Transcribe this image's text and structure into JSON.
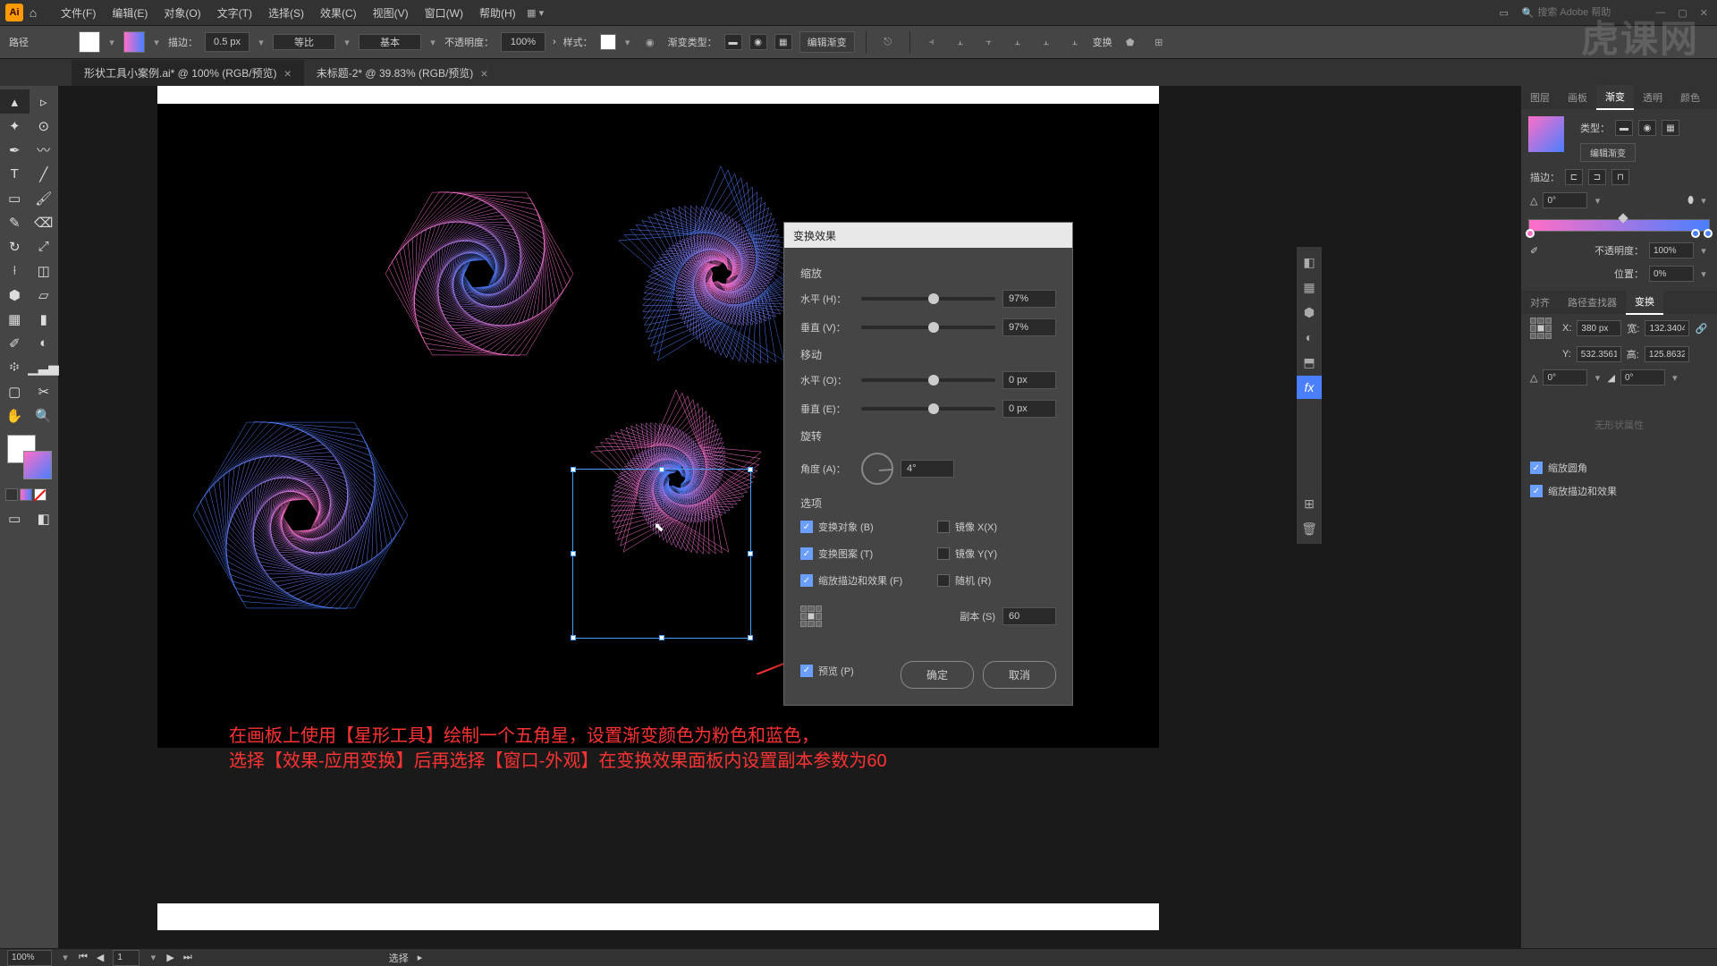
{
  "menubar": {
    "items": [
      "文件(F)",
      "编辑(E)",
      "对象(O)",
      "文字(T)",
      "选择(S)",
      "效果(C)",
      "视图(V)",
      "窗口(W)",
      "帮助(H)"
    ],
    "search_placeholder": "搜索 Adobe 帮助"
  },
  "controlbar": {
    "path_label": "路径",
    "stroke_label": "描边：",
    "stroke_width": "0.5 px",
    "profile": "等比",
    "brush": "基本",
    "opacity_label": "不透明度：",
    "opacity": "100%",
    "style_label": "样式：",
    "grad_type_label": "渐变类型：",
    "edit_gradient": "编辑渐变",
    "transform_label": "变换"
  },
  "tabs": [
    {
      "title": "形状工具小案例.ai* @ 100% (RGB/预览)",
      "active": true
    },
    {
      "title": "未标题-2* @ 39.83% (RGB/预览)",
      "active": false
    }
  ],
  "dialog": {
    "title": "变换效果",
    "scale_section": "缩放",
    "scale_h_label": "水平 (H)：",
    "scale_h": "97%",
    "scale_v_label": "垂直 (V)：",
    "scale_v": "97%",
    "move_section": "移动",
    "move_h_label": "水平 (O)：",
    "move_h": "0 px",
    "move_v_label": "垂直 (E)：",
    "move_v": "0 px",
    "rotate_section": "旋转",
    "angle_label": "角度 (A)：",
    "angle": "4°",
    "options_section": "选项",
    "opt_transform_obj": "变换对象 (B)",
    "opt_transform_pat": "变换图案 (T)",
    "opt_scale_strokes": "缩放描边和效果 (F)",
    "opt_mirror_x": "镜像 X(X)",
    "opt_mirror_y": "镜像 Y(Y)",
    "opt_random": "随机 (R)",
    "copies_label": "副本 (S)",
    "copies": "60",
    "preview": "预览 (P)",
    "ok": "确定",
    "cancel": "取消"
  },
  "panels": {
    "tabs_top": [
      "图层",
      "画板",
      "渐变",
      "透明",
      "颜色"
    ],
    "type_label": "类型：",
    "edit_grad": "编辑渐变",
    "stroke_label": "描边：",
    "angle": "0°",
    "opacity_label": "不透明度：",
    "opacity": "100%",
    "pos_label": "位置：",
    "pos": "0%",
    "tabs_mid": [
      "对齐",
      "路径查找器",
      "变换"
    ],
    "x": "380 px",
    "w": "132.3404",
    "y": "532.3561",
    "h": "125.8632",
    "rot": "0°",
    "shear": "0°",
    "scale_corners": "缩放圆角",
    "scale_strokes": "缩放描边和效果",
    "no_appearance": "无形状属性"
  },
  "annotations": {
    "line1": "在画板上使用【星形工具】绘制一个五角星，设置渐变颜色为粉色和蓝色，",
    "line2": "选择【效果-应用变换】后再选择【窗口-外观】在变换效果面板内设置副本参数为60"
  },
  "statusbar": {
    "zoom": "100%",
    "page": "1",
    "mode": "选择"
  },
  "watermark": "虎课网"
}
